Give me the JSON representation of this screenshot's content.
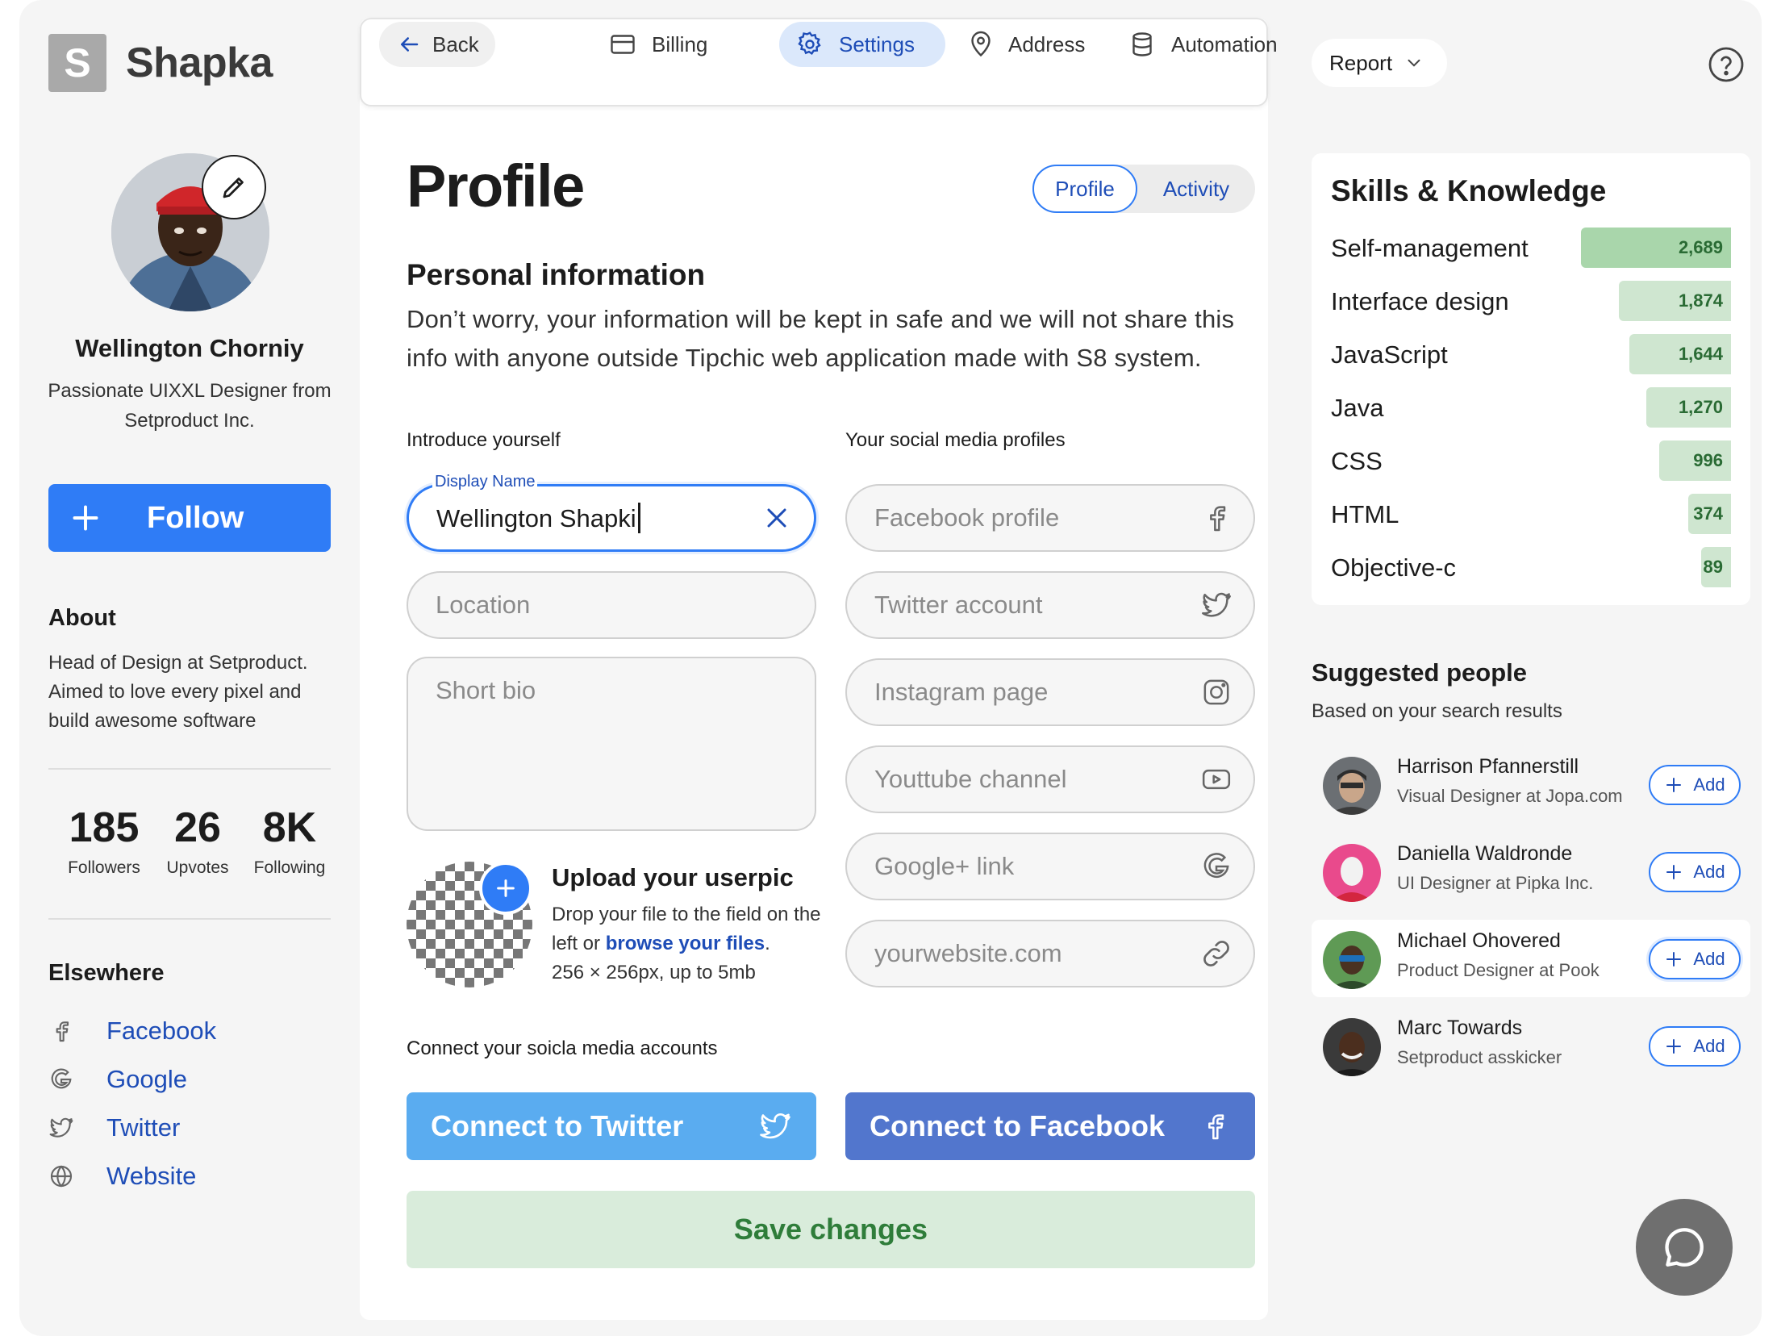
{
  "app": {
    "logo_letter": "S",
    "name": "Shapka"
  },
  "user": {
    "name": "Wellington Chorniy",
    "title": "Passionate UIXXL Designer from Setproduct Inc.",
    "follow_label": "Follow",
    "about_heading": "About",
    "about_text": "Head of Design at Setproduct. Aimed to love every pixel and build awesome software",
    "stats": [
      {
        "value": "185",
        "label": "Followers"
      },
      {
        "value": "26",
        "label": "Upvotes"
      },
      {
        "value": "8K",
        "label": "Following"
      }
    ],
    "elsewhere_heading": "Elsewhere",
    "elsewhere": [
      {
        "label": "Facebook",
        "icon": "facebook-icon"
      },
      {
        "label": "Google",
        "icon": "google-icon"
      },
      {
        "label": "Twitter",
        "icon": "twitter-icon"
      },
      {
        "label": "Website",
        "icon": "globe-icon"
      }
    ]
  },
  "nav": {
    "back": "Back",
    "items": [
      {
        "label": "Billing",
        "icon": "card-icon"
      },
      {
        "label": "Settings",
        "icon": "gear-icon",
        "active": true
      },
      {
        "label": "Address",
        "icon": "pin-icon"
      },
      {
        "label": "Automation",
        "icon": "database-icon"
      }
    ]
  },
  "profile": {
    "title": "Profile",
    "tabs": [
      "Profile",
      "Activity"
    ],
    "active_tab": "Profile",
    "personal_heading": "Personal information",
    "personal_desc": "Don’t worry, your information will be kept in safe and we will not share this info with anyone outside Tipchic web application made with S8 system.",
    "intro_label": "Introduce yourself",
    "social_label": "Your social media profiles",
    "display_name_label": "Display Name",
    "display_name_value": "Wellington Shapki",
    "location_placeholder": "Location",
    "bio_placeholder": "Short bio",
    "social_fields": [
      {
        "placeholder": "Facebook profile",
        "icon": "facebook-icon"
      },
      {
        "placeholder": "Twitter account",
        "icon": "twitter-icon"
      },
      {
        "placeholder": "Instagram page",
        "icon": "instagram-icon"
      },
      {
        "placeholder": "Youttube channel",
        "icon": "youtube-icon"
      },
      {
        "placeholder": "Google+ link",
        "icon": "google-icon"
      },
      {
        "placeholder": "yourwebsite.com",
        "icon": "link-icon"
      }
    ],
    "upload_title": "Upload your userpic",
    "upload_desc_1": "Drop your file to the field on the left or ",
    "upload_link": "browse your files",
    "upload_desc_2": ".",
    "upload_desc_3": "256 × 256px, up to 5mb",
    "connect_label": "Connect your soicla media accounts",
    "connect_twitter": "Connect to Twitter",
    "connect_facebook": "Connect to Facebook",
    "save_label": "Save changes",
    "colors": {
      "twitter": "#5aacf0",
      "facebook": "#5276cd",
      "accent": "#2f7cf6"
    }
  },
  "right": {
    "report_label": "Report",
    "skills_heading": "Skills & Knowledge",
    "skills": [
      {
        "name": "Self-management",
        "value": "2,689",
        "n": 2689
      },
      {
        "name": "Interface design",
        "value": "1,874",
        "n": 1874
      },
      {
        "name": "JavaScript",
        "value": "1,644",
        "n": 1644
      },
      {
        "name": "Java",
        "value": "1,270",
        "n": 1270
      },
      {
        "name": "CSS",
        "value": "996",
        "n": 996
      },
      {
        "name": "HTML",
        "value": "374",
        "n": 374
      },
      {
        "name": "Objective-c",
        "value": "89",
        "n": 89
      }
    ],
    "suggested_heading": "Suggested people",
    "suggested_sub": "Based on your search results",
    "people": [
      {
        "name": "Harrison Pfannerstill",
        "role": "Visual Designer at Jopa.com",
        "add": "Add"
      },
      {
        "name": "Daniella Waldronde",
        "role": "UI Designer at Pipka Inc.",
        "add": "Add"
      },
      {
        "name": "Michael Ohovered",
        "role": "Product Designer at Pook",
        "add": "Add"
      },
      {
        "name": "Marc Towards",
        "role": "Setproduct asskicker",
        "add": "Add"
      }
    ]
  }
}
